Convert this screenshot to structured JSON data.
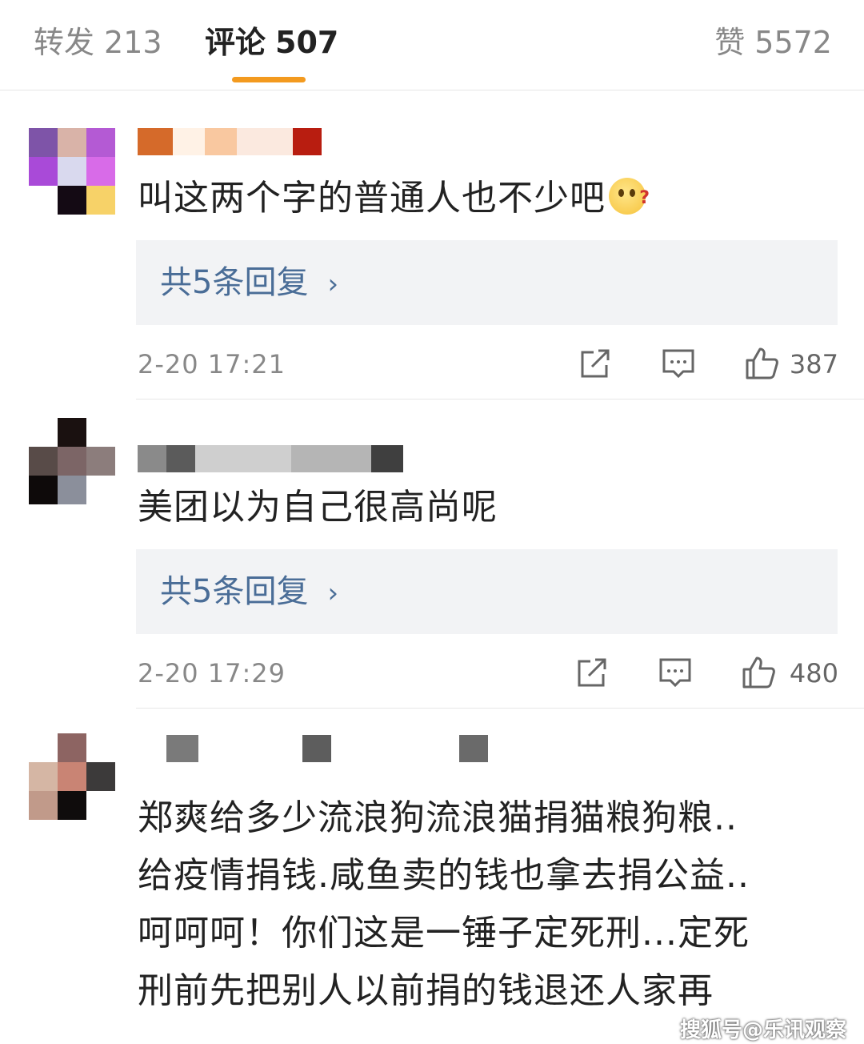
{
  "tabs": {
    "forward": {
      "label": "转发",
      "count": "213"
    },
    "comments": {
      "label": "评论",
      "count": "507"
    },
    "likes": {
      "label": "赞",
      "count": "5572"
    }
  },
  "comments": [
    {
      "text": "叫这两个字的普通人也不少吧",
      "emoji": "thinking-question-emoji",
      "reply_label": "共5条回复",
      "time": "2-20 17:21",
      "likes": "387"
    },
    {
      "text": "美团以为自己很高尚呢",
      "reply_label": "共5条回复",
      "time": "2-20 17:29",
      "likes": "480"
    },
    {
      "lines": [
        "郑爽给多少流浪狗流浪猫捐猫粮狗粮..",
        "给疫情捐钱.咸鱼卖的钱也拿去捐公益..",
        "呵呵呵！你们这是一锤子定死刑...定死",
        "刑前先把别人以前捐的钱退还人家再"
      ]
    }
  ],
  "icons": {
    "share": "share-icon",
    "comment": "comment-icon",
    "like": "thumbs-up-icon",
    "reply_arrow": "chevron-right-icon"
  },
  "colors": {
    "accent": "#f39a1f",
    "reply_link": "#4a6d97",
    "reply_bg": "#f2f3f5"
  },
  "watermark": "搜狐号@乐讯观察"
}
